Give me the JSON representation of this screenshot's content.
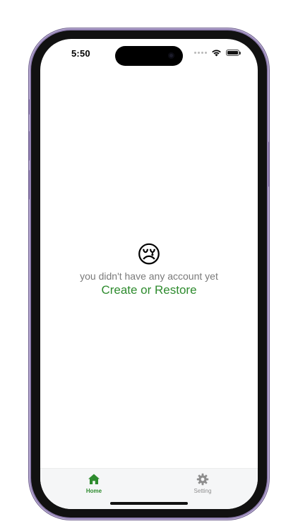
{
  "status_bar": {
    "time": "5:50",
    "signal_icon": "signal-dots-icon",
    "wifi_icon": "wifi-icon",
    "battery_icon": "battery-icon"
  },
  "empty_state": {
    "emoji": "😢",
    "message": "you didn't have any account yet",
    "action_label": "Create or Restore"
  },
  "tab_bar": {
    "items": [
      {
        "label": "Home",
        "icon": "home-icon",
        "active": true
      },
      {
        "label": "Setting",
        "icon": "gear-icon",
        "active": false
      }
    ]
  },
  "colors": {
    "accent": "#2e8b2e",
    "muted_text": "#7a7a7a",
    "inactive_tab": "#8e8e8e",
    "tab_bar_background": "#f5f6f7",
    "frame": "#8f7eb0"
  }
}
